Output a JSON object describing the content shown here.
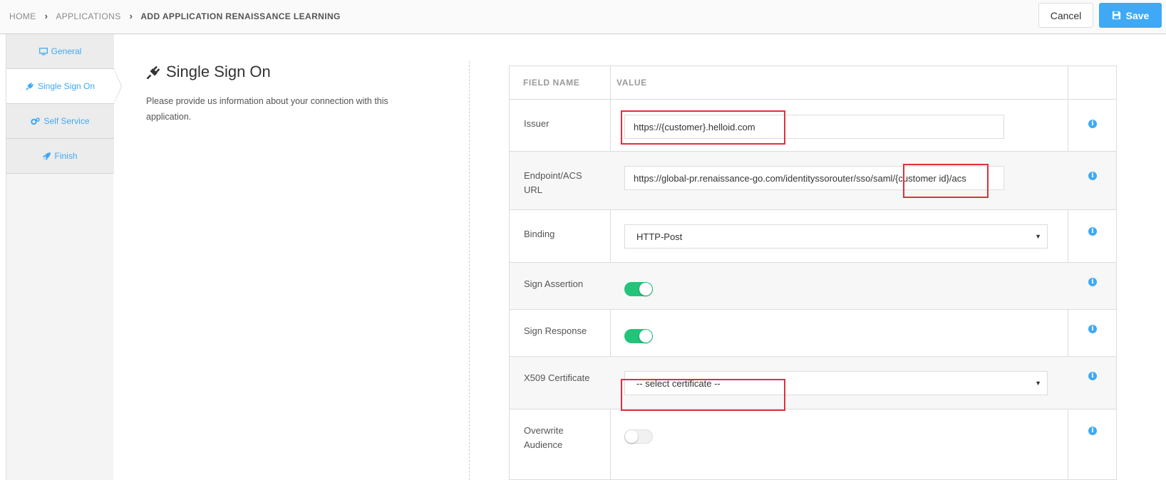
{
  "breadcrumb": {
    "home": "HOME",
    "applications": "APPLICATIONS",
    "current": "ADD APPLICATION RENAISSANCE LEARNING"
  },
  "toolbar": {
    "cancel_label": "Cancel",
    "save_label": "Save"
  },
  "sidebar": {
    "items": [
      {
        "label": "General",
        "icon": "monitor-icon"
      },
      {
        "label": "Single Sign On",
        "icon": "plug-icon",
        "active": true
      },
      {
        "label": "Self Service",
        "icon": "gears-icon"
      },
      {
        "label": "Finish",
        "icon": "rocket-icon"
      }
    ]
  },
  "intro": {
    "title": "Single Sign On",
    "description": "Please provide us information about your connection with this application."
  },
  "table": {
    "headers": {
      "field": "FIELD NAME",
      "value": "VALUE"
    },
    "rows": {
      "issuer": {
        "label": "Issuer",
        "value": "https://{customer}.helloid.com"
      },
      "endpoint": {
        "label": "Endpoint/ACS URL",
        "value": "https://global-pr.renaissance-go.com/identityssorouter/sso/saml/{customer id}/acs"
      },
      "binding": {
        "label": "Binding",
        "value": "HTTP-Post"
      },
      "sign_assertion": {
        "label": "Sign Assertion",
        "enabled": true
      },
      "sign_response": {
        "label": "Sign Response",
        "enabled": true
      },
      "x509": {
        "label": "X509 Certificate",
        "value": "-- select certificate --"
      },
      "overwrite_audience": {
        "label": "Overwrite Audience",
        "enabled": false
      }
    }
  },
  "colors": {
    "accent": "#3fa9f5",
    "toggle_on": "#22c47a",
    "highlight": "#e0303a"
  }
}
